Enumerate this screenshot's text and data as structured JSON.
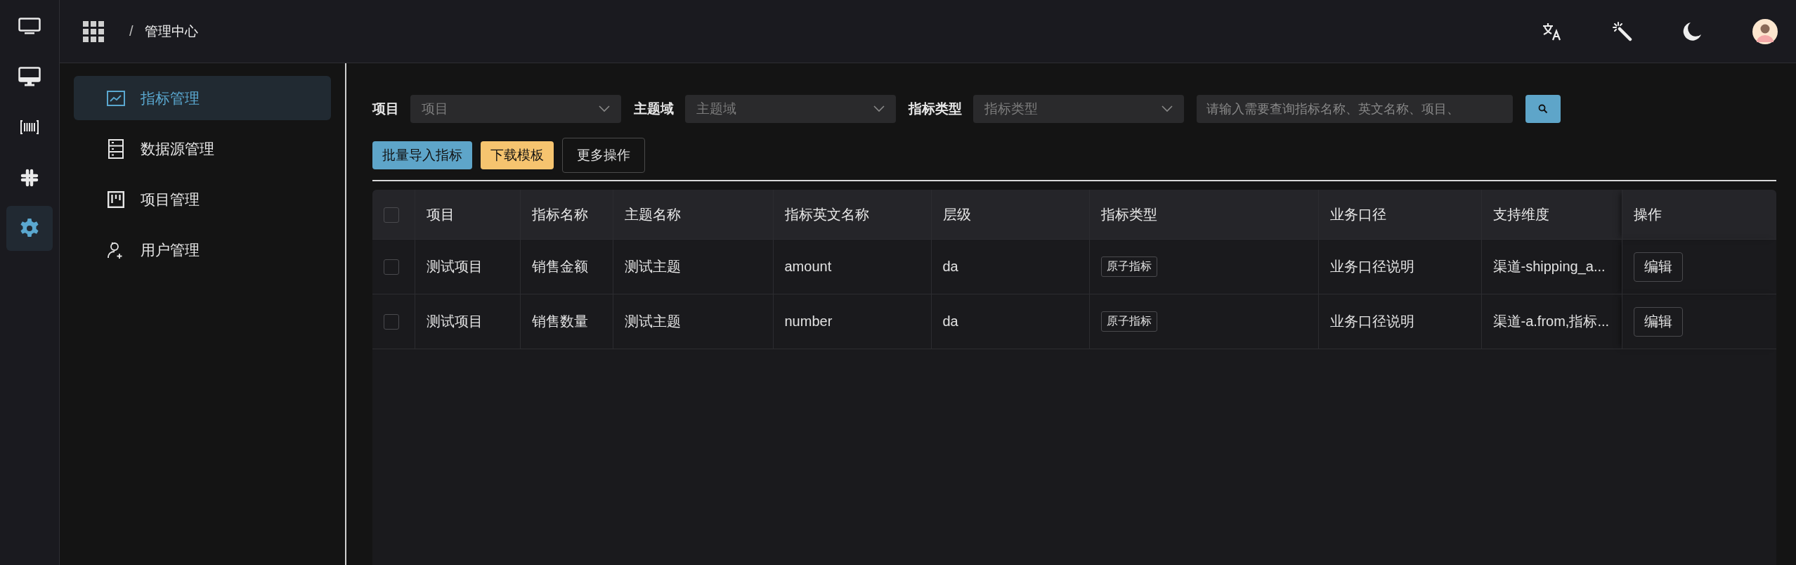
{
  "rail": [
    {
      "kind": "monitor",
      "selected": false
    },
    {
      "kind": "desktop",
      "selected": false
    },
    {
      "kind": "barcode",
      "selected": false
    },
    {
      "kind": "hash",
      "selected": false
    },
    {
      "kind": "gear",
      "selected": true
    }
  ],
  "header": {
    "breadcrumb": [
      "/",
      "管理中心"
    ]
  },
  "sidebar": {
    "items": [
      {
        "kind": "chart",
        "label": "指标管理",
        "selected": true
      },
      {
        "kind": "server",
        "label": "数据源管理",
        "selected": false
      },
      {
        "kind": "board",
        "label": "项目管理",
        "selected": false
      },
      {
        "kind": "users",
        "label": "用户管理",
        "selected": false
      }
    ]
  },
  "filters": [
    {
      "label": "项目",
      "placeholder": "项目"
    },
    {
      "label": "主题域",
      "placeholder": "主题域"
    },
    {
      "label": "指标类型",
      "placeholder": "指标类型"
    }
  ],
  "search": {
    "placeholder": "请输入需要查询指标名称、英文名称、项目、"
  },
  "actions": [
    {
      "kind": "primary",
      "label": "批量导入指标"
    },
    {
      "kind": "warning",
      "label": "下载模板"
    },
    {
      "kind": "outline",
      "label": "更多操作"
    }
  ],
  "table": {
    "select_all_checked": false,
    "columns": [
      "项目",
      "指标名称",
      "主题名称",
      "指标英文名称",
      "层级",
      "指标类型",
      "业务口径",
      "支持维度",
      "操作"
    ],
    "rows": [
      {
        "checked": false,
        "cells": [
          "测试项目",
          "销售金额",
          "测试主题",
          "amount",
          "da"
        ],
        "type_tag": "原子指标",
        "caliber": "业务口径说明",
        "dimensions": "渠道-shipping_a...",
        "action": "编辑"
      },
      {
        "checked": false,
        "cells": [
          "测试项目",
          "销售数量",
          "测试主题",
          "number",
          "da"
        ],
        "type_tag": "原子指标",
        "caliber": "业务口径说明",
        "dimensions": "渠道-a.from,指标...",
        "action": "编辑"
      }
    ]
  }
}
